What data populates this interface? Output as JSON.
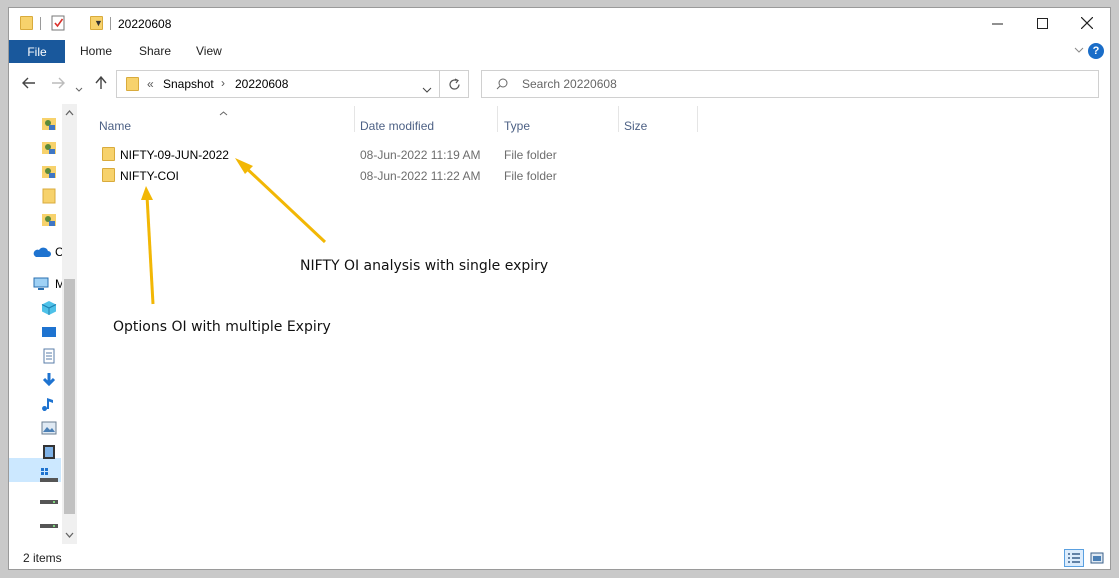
{
  "window": {
    "title": "20220608"
  },
  "ribbon": {
    "file": "File",
    "home": "Home",
    "share": "Share",
    "view": "View",
    "help": "?"
  },
  "address": {
    "sep": "«",
    "crumbs": [
      "Snapshot",
      "20220608"
    ]
  },
  "search": {
    "placeholder": "Search 20220608"
  },
  "columns": {
    "name": "Name",
    "date": "Date modified",
    "type": "Type",
    "size": "Size"
  },
  "files": [
    {
      "name": "NIFTY-09-JUN-2022",
      "date": "08-Jun-2022 11:19 AM",
      "type": "File folder"
    },
    {
      "name": "NIFTY-COI",
      "date": "08-Jun-2022 11:22 AM",
      "type": "File folder"
    }
  ],
  "navpane": {
    "onedrive_label": "C",
    "thispc_label": "M"
  },
  "annotations": {
    "single": "NIFTY OI analysis with single expiry",
    "multiple": "Options OI with multiple Expiry"
  },
  "status": {
    "items": "2 items"
  },
  "colors": {
    "file_tab": "#19589c",
    "folder": "#f7d26c",
    "arrow": "#f2b705",
    "selection": "#cce8ff"
  }
}
